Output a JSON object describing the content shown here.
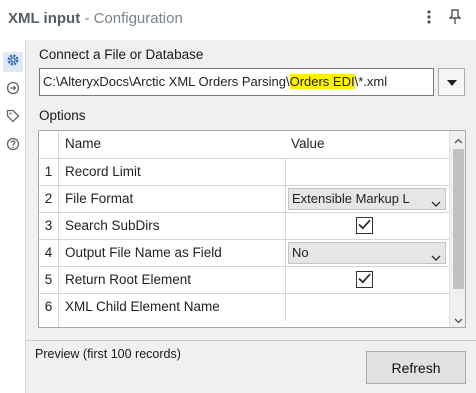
{
  "header": {
    "title_name": "XML input",
    "title_sep": " - ",
    "title_sub": "Configuration"
  },
  "icons": {
    "header": [
      "more-vertical-icon",
      "pin-icon"
    ],
    "rail": [
      "gear-icon",
      "connections-icon",
      "tag-icon",
      "help-icon"
    ],
    "dropdown": "chevron-down-icon",
    "check": "check-icon"
  },
  "source": {
    "label": "Connect a File or Database",
    "path_prefix": "C:\\AlteryxDocs\\Arctic XML Orders Parsing\\",
    "path_highlight": "Orders EDI",
    "path_suffix": "\\*.xml",
    "highlight_color": "#fff200"
  },
  "options": {
    "label": "Options",
    "columns": {
      "name": "Name",
      "value": "Value"
    },
    "rows": [
      {
        "num": "1",
        "name": "Record Limit",
        "value": ""
      },
      {
        "num": "2",
        "name": "File Format",
        "value": "Extensible Markup L"
      },
      {
        "num": "3",
        "name": "Search SubDirs",
        "checked": true
      },
      {
        "num": "4",
        "name": "Output File Name as Field",
        "value": "No"
      },
      {
        "num": "5",
        "name": "Return Root Element",
        "checked": true
      },
      {
        "num": "6",
        "name": "XML Child Element Name",
        "value": ""
      }
    ]
  },
  "footer": {
    "preview_label": "Preview (first 100 records)",
    "refresh_label": "Refresh"
  }
}
